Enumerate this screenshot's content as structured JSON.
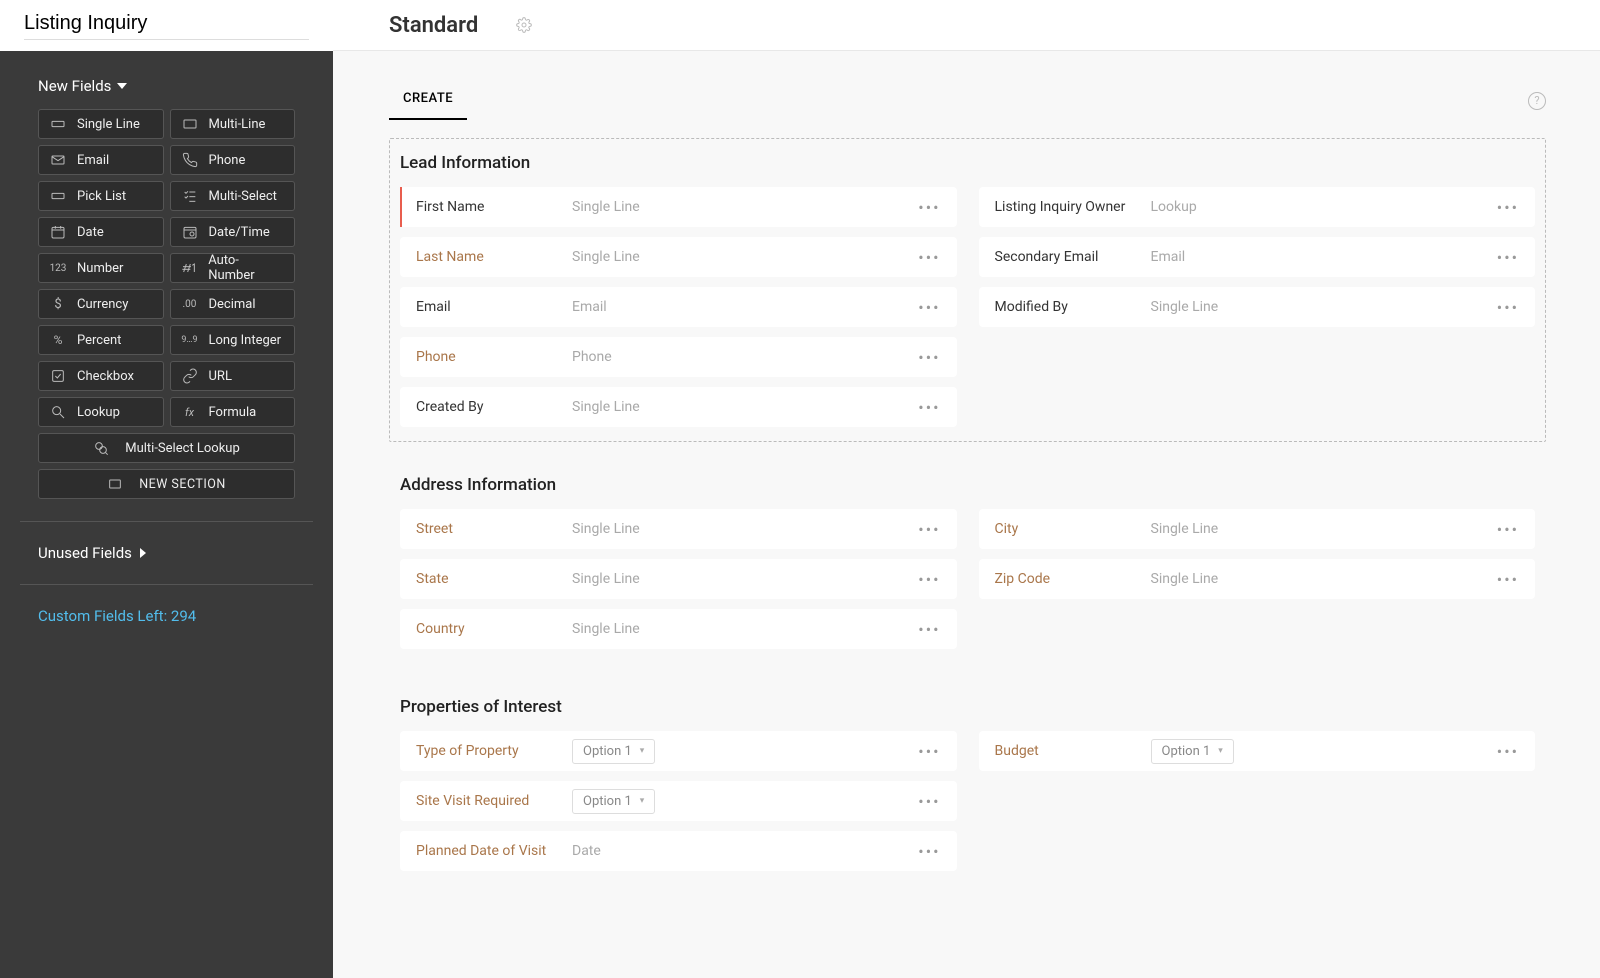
{
  "header": {
    "title": "Listing Inquiry",
    "module_name": "Standard"
  },
  "sidebar": {
    "new_fields_label": "New Fields",
    "fields": [
      {
        "key": "single-line",
        "label": "Single Line"
      },
      {
        "key": "multi-line",
        "label": "Multi-Line"
      },
      {
        "key": "email",
        "label": "Email"
      },
      {
        "key": "phone",
        "label": "Phone"
      },
      {
        "key": "pick-list",
        "label": "Pick List"
      },
      {
        "key": "multi-select",
        "label": "Multi-Select"
      },
      {
        "key": "date",
        "label": "Date"
      },
      {
        "key": "datetime",
        "label": "Date/Time"
      },
      {
        "key": "number",
        "label": "Number"
      },
      {
        "key": "auto-number",
        "label": "Auto-Number"
      },
      {
        "key": "currency",
        "label": "Currency"
      },
      {
        "key": "decimal",
        "label": "Decimal"
      },
      {
        "key": "percent",
        "label": "Percent"
      },
      {
        "key": "long-integer",
        "label": "Long Integer"
      },
      {
        "key": "checkbox",
        "label": "Checkbox"
      },
      {
        "key": "url",
        "label": "URL"
      },
      {
        "key": "lookup",
        "label": "Lookup"
      },
      {
        "key": "formula",
        "label": "Formula"
      }
    ],
    "multi_select_lookup": "Multi-Select Lookup",
    "new_section": "NEW SECTION",
    "unused_fields_label": "Unused Fields",
    "custom_fields_left": "Custom Fields Left: 294"
  },
  "tabs": {
    "create": "CREATE"
  },
  "sections": [
    {
      "title": "Lead Information",
      "dashed": true,
      "rows": [
        {
          "l": {
            "label": "First Name",
            "type": "Single Line",
            "custom": false,
            "required": true
          },
          "r": {
            "label": "Listing Inquiry Owner",
            "type": "Lookup",
            "custom": false
          }
        },
        {
          "l": {
            "label": "Last Name",
            "type": "Single Line",
            "custom": true
          },
          "r": {
            "label": "Secondary Email",
            "type": "Email",
            "custom": false
          }
        },
        {
          "l": {
            "label": "Email",
            "type": "Email",
            "custom": false
          },
          "r": {
            "label": "Modified By",
            "type": "Single Line",
            "custom": false
          }
        },
        {
          "l": {
            "label": "Phone",
            "type": "Phone",
            "custom": true
          },
          "r": null
        },
        {
          "l": {
            "label": "Created By",
            "type": "Single Line",
            "custom": false
          },
          "r": null
        }
      ]
    },
    {
      "title": "Address Information",
      "dashed": false,
      "rows": [
        {
          "l": {
            "label": "Street",
            "type": "Single Line",
            "custom": true
          },
          "r": {
            "label": "City",
            "type": "Single Line",
            "custom": true
          }
        },
        {
          "l": {
            "label": "State",
            "type": "Single Line",
            "custom": true
          },
          "r": {
            "label": "Zip Code",
            "type": "Single Line",
            "custom": true
          }
        },
        {
          "l": {
            "label": "Country",
            "type": "Single Line",
            "custom": true
          },
          "r": null
        }
      ]
    },
    {
      "title": "Properties of Interest",
      "dashed": false,
      "rows": [
        {
          "l": {
            "label": "Type of Property",
            "type": "select",
            "select": "Option 1",
            "custom": true
          },
          "r": {
            "label": "Budget",
            "type": "select",
            "select": "Option 1",
            "custom": true
          }
        },
        {
          "l": {
            "label": "Site Visit Required",
            "type": "select",
            "select": "Option 1",
            "custom": true
          },
          "r": null
        },
        {
          "l": {
            "label": "Planned Date of Visit",
            "type": "Date",
            "custom": true
          },
          "r": null
        }
      ]
    }
  ]
}
